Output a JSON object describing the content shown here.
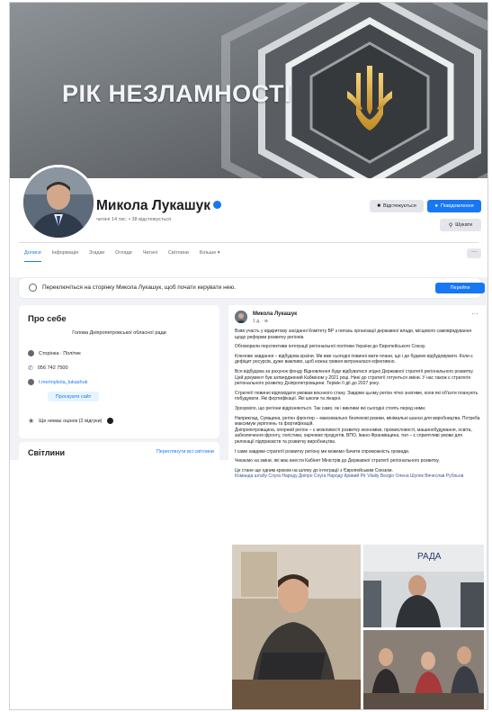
{
  "cover": {
    "slogan": "РІК НЕЗЛАМНОСТІ"
  },
  "profile": {
    "name": "Микола Лукашук",
    "followers": "читачі 14 тис. • 38 відстежується",
    "buttons": {
      "follow": "Відстежується",
      "message": "Повідомлення",
      "search": "Шукати"
    }
  },
  "tabs": [
    "Дописи",
    "Інформація",
    "Згадки",
    "Огляди",
    "Читачі",
    "Світлини",
    "Більше ▾"
  ],
  "tabs_more": "···",
  "switch_bar": {
    "text": "Переключіться на сторінку Микола Лукашук, щоб почати керувати нею.",
    "button": "Перейти"
  },
  "intro": {
    "title": "Про себе",
    "bio": "Голова Дніпропетровської обласної ради",
    "category": "Сторінка · Політик",
    "phone": "056 742 7500",
    "link": "t.me/mykola_lukashuk",
    "site_button": "Проскуати сайт",
    "rating": "Ще немає оцінок (2 відгуки)"
  },
  "photos": {
    "title": "Світлини",
    "link": "Переглянути всі світлини"
  },
  "post": {
    "author": "Микола Лукашук",
    "time": "1 д. · ⊕",
    "more": "···",
    "paragraphs": [
      "Взяв участь у відкритому засіданні Комітету ВР з питань організації державної влади, місцевого самоврядування щодо реформи розвитку регіонів.",
      "Обговорили перспективи інтеграції регіональної політики України до Європейського Союзу.",
      "Ключове завдання – відбудова країни. Ми вже сьогодні повинні мати плани, що і де будемо відбудовувати. Коли є дефіцит ресурсів, дуже важливо, щоб кожна гривня витрачалася ефективно.",
      "Вся відбудова за рахунок фонду Відновлення буде відбуватися згідно Державної стратегії регіонального розвитку. Цей документ був затверджений Кабміном у 2021 році. Нині до стратегії готуються зміни. У нас також є стратегія регіонального розвитку Дніпропетровщини. Термін її дії до 2027 року.",
      "Стратегії повинні відповідати умовам воєнного стану. Завдяки цьому регіон чітко знатиме, коли які об'єкти планують побудувати. Які фортифікації. Які школи та лікарні.",
      "Зрозуміло, що регіони відрізняються. Так само, як і виклики які сьогодні стоять перед ними.",
      "Наприклад, Сумщина, регіон фронтир – максимально безпекові ризики, мінімальні шанси для виробництва. Потреба максимум укріплень та фортифікацій.",
      "Дніпропетровщина, опорний регіон – є можливості розвитку економіки, промисловості, машинобудування, освіта, забезпечення фронту, логістики, харчових продуктів, ВПО, Івано-Франківщина, тил – є сприятливі умови для релокації підприємств та розвитку виробництва.",
      "І саме завдяки стратегії розвитку регіону ми можемо бачити спроможність громади.",
      "Чекаємо на зміни, які має внести Кабінет Міністрів до Державної стратегії регіонального розвитку.",
      "Це стане ще одним кроком на шляху до інтеграції з Європейським Союзом."
    ],
    "tags": "Команда штабу Слуга Народу Дніпро Слуга Народу Кривий Ріг Vitaliy Bezgin Олена Шуляк Вячеслав Рубльов",
    "screen_text": "РАДА"
  },
  "colors": {
    "accent": "#1877f2",
    "background": "#f0f2f5",
    "text": "#1c1e21",
    "muted": "#65676b"
  }
}
